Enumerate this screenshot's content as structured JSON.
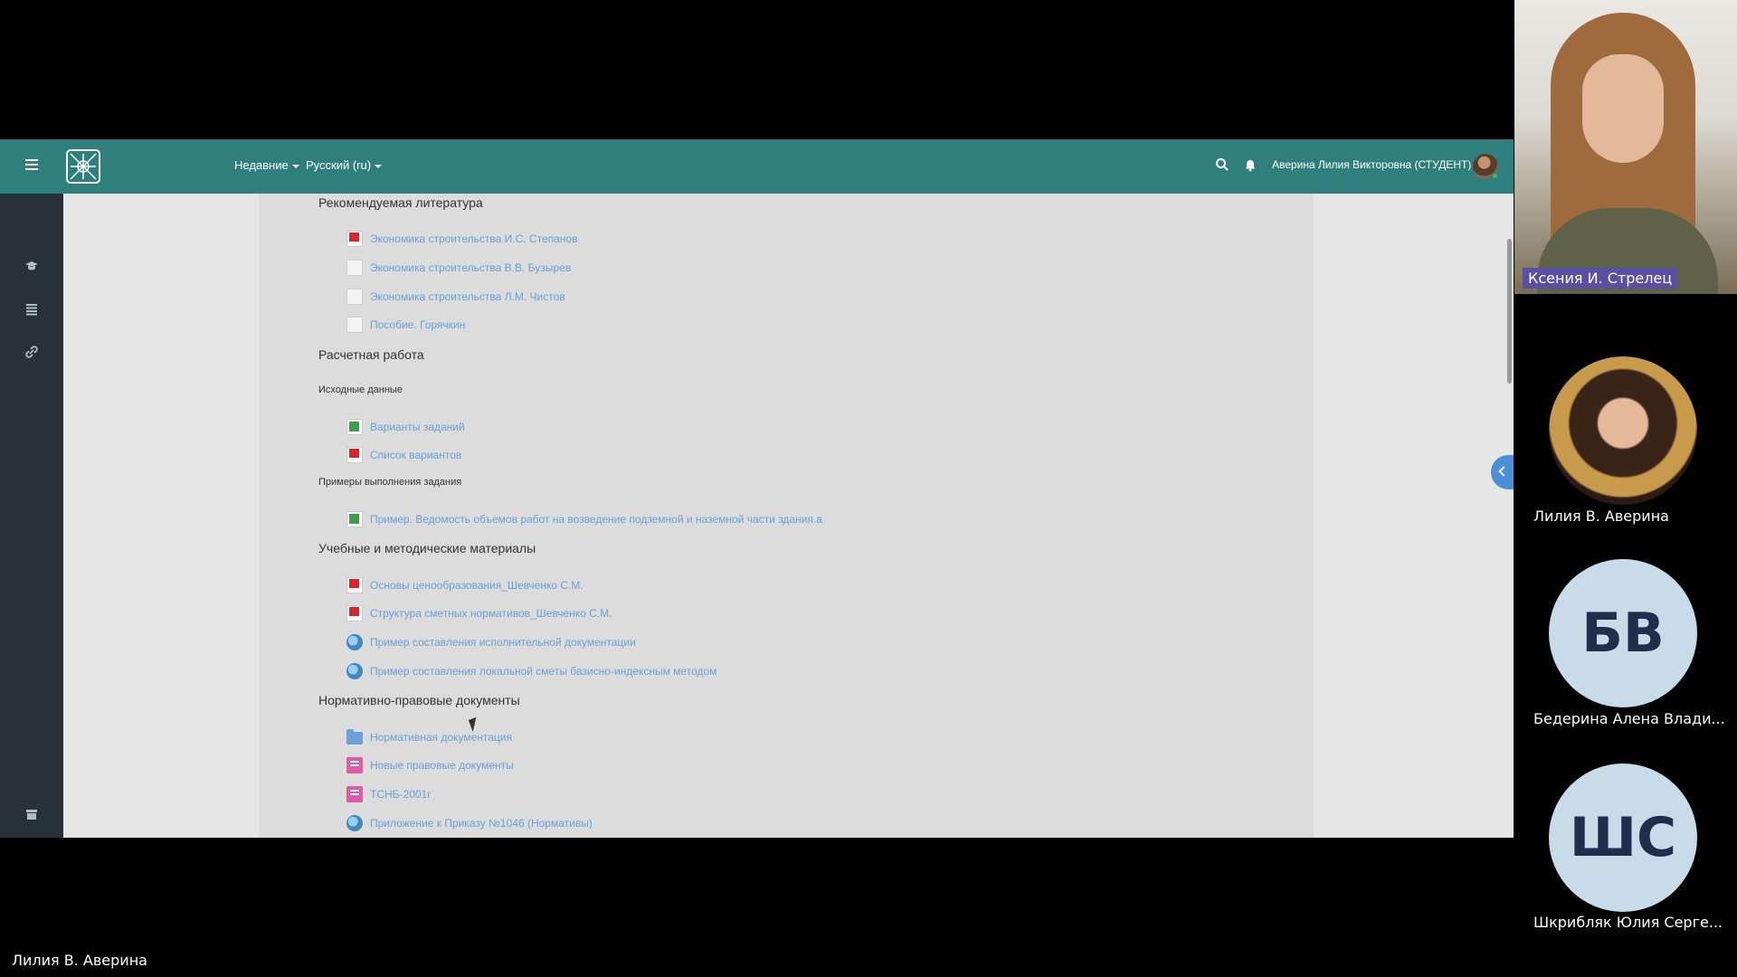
{
  "navbar": {
    "recent_label": "Недавние",
    "language_label": "Русский (ru)",
    "user_name": "Аверина Лилия Викторовна (СТУДЕНТ)"
  },
  "drawer": {
    "icons": [
      "graduation-cap-icon",
      "list-icon",
      "link-icon",
      "archive-icon"
    ]
  },
  "course": {
    "sections": [
      {
        "title": "Рекомендуемая литература",
        "items": [
          {
            "label": "Экономика строительства И.С. Степанов",
            "icon": "pdf-icon"
          },
          {
            "label": "Экономика строительства В.В. Бузырев",
            "icon": "file-icon"
          },
          {
            "label": "Экономика строительства Л.М. Чистов",
            "icon": "file-icon"
          },
          {
            "label": "Пособие. Горячкин",
            "icon": "file-icon"
          }
        ]
      },
      {
        "title": "Расчетная работа",
        "sublabel1": "Исходные данные",
        "items1": [
          {
            "label": "Варианты заданий",
            "icon": "spreadsheet-icon"
          },
          {
            "label": "Список вариантов",
            "icon": "pdf-icon"
          }
        ],
        "sublabel2": "Примеры выполнения задания",
        "items2": [
          {
            "label": "Пример. Ведомость объемов работ на возведение подземной и наземной части здания.a",
            "icon": "spreadsheet-icon"
          }
        ]
      },
      {
        "title": "Учебные и методические материалы",
        "items": [
          {
            "label": "Основы ценообразования_Шевченко С.М.",
            "icon": "pdf-icon"
          },
          {
            "label": "Структура сметных нормативов_Шевченко С.М.",
            "icon": "pdf-icon"
          },
          {
            "label": "Пример составления исполнительной документации",
            "icon": "web-icon"
          },
          {
            "label": "Пример составления локальной сметы базисно-индексным методом",
            "icon": "web-icon"
          }
        ]
      },
      {
        "title": "Нормативно-правовые документы",
        "items": [
          {
            "label": "Нормативная документация",
            "icon": "folder-icon"
          },
          {
            "label": "Новые правовые документы",
            "icon": "book-icon"
          },
          {
            "label": "ТСНБ-2001г",
            "icon": "book-icon"
          },
          {
            "label": "Приложение к Приказу №1046 (Нормативы)",
            "icon": "web-icon"
          }
        ]
      }
    ]
  },
  "participants": {
    "speaker": "Ксения И. Стрелец",
    "p1": "Лилия В. Аверина",
    "p2_initials": "БВ",
    "p2_name": "Бедерина Алена Влади...",
    "p3_initials": "ШС",
    "p3_name": "Шкрибляк Юлия Серге...",
    "self_name": "Лилия В. Аверина"
  }
}
